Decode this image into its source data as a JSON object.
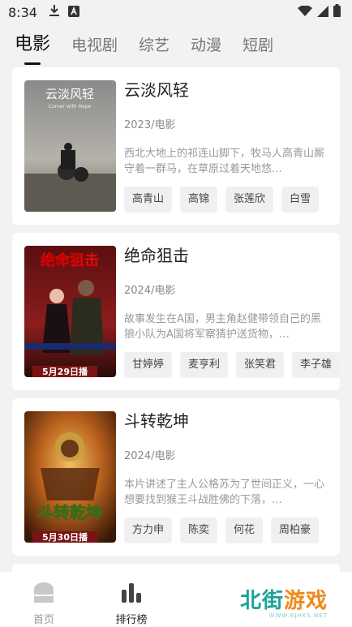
{
  "status_bar": {
    "time": "8:34"
  },
  "tabs": [
    {
      "label": "电影",
      "active": true
    },
    {
      "label": "电视剧"
    },
    {
      "label": "综艺"
    },
    {
      "label": "动漫"
    },
    {
      "label": "短剧"
    }
  ],
  "movies": [
    {
      "title": "云淡风轻",
      "meta": "2023/电影",
      "description": "西北大地上的祁连山脚下，牧马人高青山厮守着一群马，在草原过着天地悠…",
      "cast": [
        "高青山",
        "高锦",
        "张莲欣",
        "白雪"
      ],
      "poster_title": "云淡风轻",
      "poster_subtitle": "Corner with Hope"
    },
    {
      "title": "绝命狙击",
      "meta": "2024/电影",
      "description": "故事发生在A国，男主角赵健带领自己的黑狼小队为A国将军察猜护送货物，…",
      "cast": [
        "甘婷婷",
        "麦亨利",
        "张笑君",
        "李子雄"
      ],
      "poster_title": "绝命狙击",
      "poster_date": "5月29日播"
    },
    {
      "title": "斗转乾坤",
      "meta": "2024/电影",
      "description": "本片讲述了主人公格苏为了世间正义，一心想要找到猴王斗战胜佛的下落，…",
      "cast": [
        "方力申",
        "陈奕",
        "何花",
        "周柏豪"
      ],
      "poster_title": "斗转乾坤",
      "poster_date": "5月30日播"
    }
  ],
  "bottom_nav": [
    {
      "label": "首页"
    },
    {
      "label": "排行榜",
      "active": true
    }
  ],
  "watermark": {
    "text_a": "北街",
    "text_b": "游戏",
    "url": "WWW.BJHKS.NET"
  }
}
